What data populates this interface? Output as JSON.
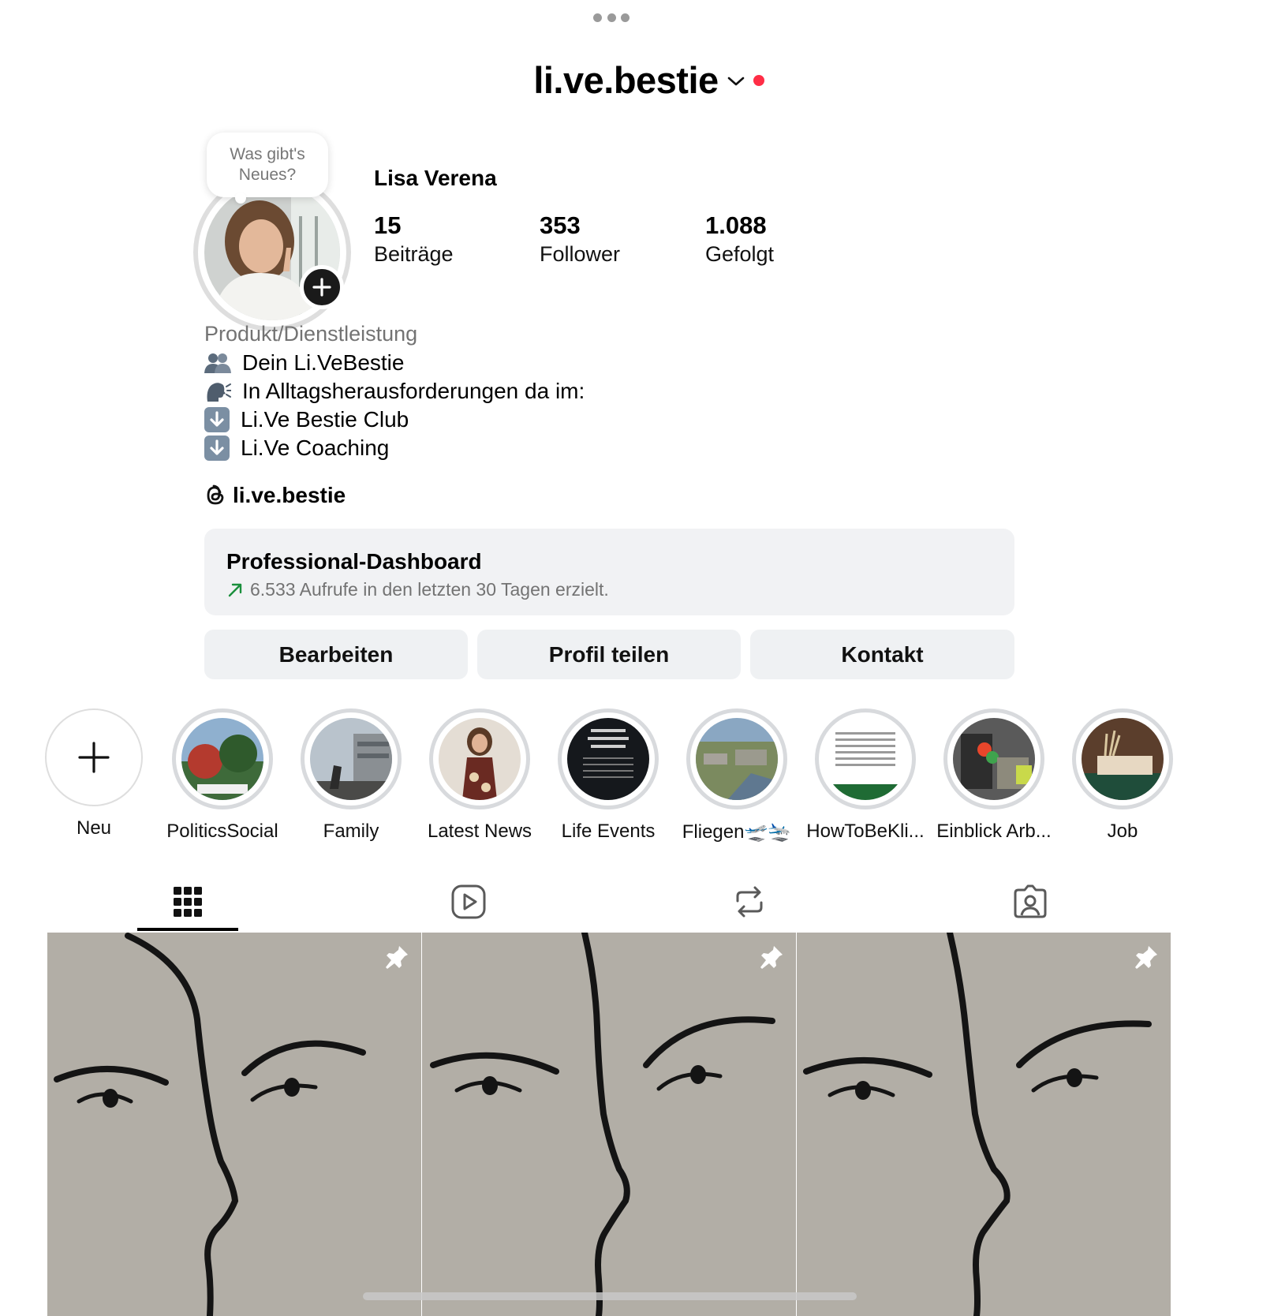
{
  "header": {
    "username": "li.ve.bestie"
  },
  "note_bubble": {
    "text": "Was gibt's Neues?"
  },
  "profile": {
    "full_name": "Lisa Verena",
    "stats": [
      {
        "value": "15",
        "label": "Beiträge"
      },
      {
        "value": "353",
        "label": "Follower"
      },
      {
        "value": "1.088",
        "label": "Gefolgt"
      }
    ],
    "category": "Produkt/Dienstleistung",
    "bio": [
      {
        "icon": "people-icon",
        "text": "Dein Li.VeBestie"
      },
      {
        "icon": "speaking-head-icon",
        "text": "In Alltagsherausforderungen da im:"
      },
      {
        "icon": "down-arrow-icon",
        "text": "Li.Ve Bestie Club"
      },
      {
        "icon": "down-arrow-icon",
        "text": "Li.Ve Coaching"
      }
    ],
    "threads_handle": "li.ve.bestie"
  },
  "dashboard": {
    "title": "Professional-Dashboard",
    "subtitle": "6.533 Aufrufe in den letzten 30 Tagen erzielt."
  },
  "buttons": {
    "edit": "Bearbeiten",
    "share": "Profil teilen",
    "contact": "Kontakt"
  },
  "highlights": [
    {
      "label": "Neu"
    },
    {
      "label": "PoliticsSocial"
    },
    {
      "label": "Family"
    },
    {
      "label": "Latest News"
    },
    {
      "label": "Life Events"
    },
    {
      "label": "Fliegen🛫🛬"
    },
    {
      "label": "HowToBeKli..."
    },
    {
      "label": "Einblick Arb..."
    },
    {
      "label": "Job"
    }
  ],
  "tabs": [
    {
      "icon": "grid-icon",
      "active": true
    },
    {
      "icon": "reels-icon"
    },
    {
      "icon": "repost-icon"
    },
    {
      "icon": "tagged-icon"
    }
  ],
  "colors": {
    "notification_dot": "#ff2d46",
    "trend_up": "#1a8f3c",
    "button_bg": "#eff1f3"
  }
}
